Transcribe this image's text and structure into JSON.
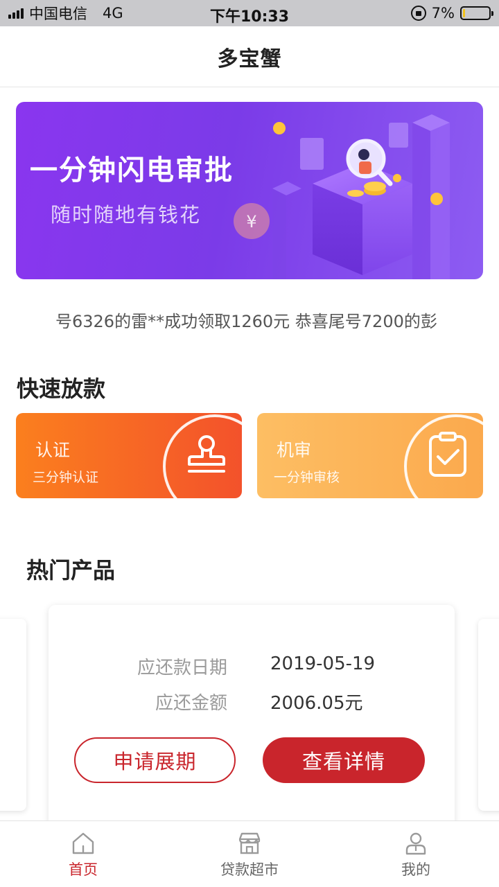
{
  "status_bar": {
    "carrier": "中国电信",
    "network": "4G",
    "time": "下午10:33",
    "battery": "7%",
    "battery_level": 0.07
  },
  "nav": {
    "title": "多宝蟹"
  },
  "banner": {
    "title": "一分钟闪电审批",
    "subtitle": "随时随地有钱花"
  },
  "ticker": {
    "text": "号6326的雷**成功领取1260元 恭喜尾号7200的彭"
  },
  "quick_section": {
    "title": "快速放款",
    "cards": [
      {
        "title": "认证",
        "subtitle": "三分钟认证"
      },
      {
        "title": "机审",
        "subtitle": "一分钟审核"
      }
    ]
  },
  "hot_section": {
    "title": "热门产品",
    "card": {
      "due_date_label": "应还款日期",
      "due_date_value": "2019-05-19",
      "amount_label": "应还金额",
      "amount_value": "2006.05元",
      "extend_button": "申请展期",
      "detail_button": "查看详情"
    }
  },
  "tabbar": {
    "items": [
      {
        "label": "首页",
        "icon": "home-icon",
        "active": true
      },
      {
        "label": "贷款超市",
        "icon": "store-icon",
        "active": false
      },
      {
        "label": "我的",
        "icon": "user-icon",
        "active": false
      }
    ]
  },
  "colors": {
    "accent": "#c9252c",
    "banner_purple": "#8a36ef",
    "quick_red": "#f3522b",
    "quick_yellow": "#fba94d"
  }
}
